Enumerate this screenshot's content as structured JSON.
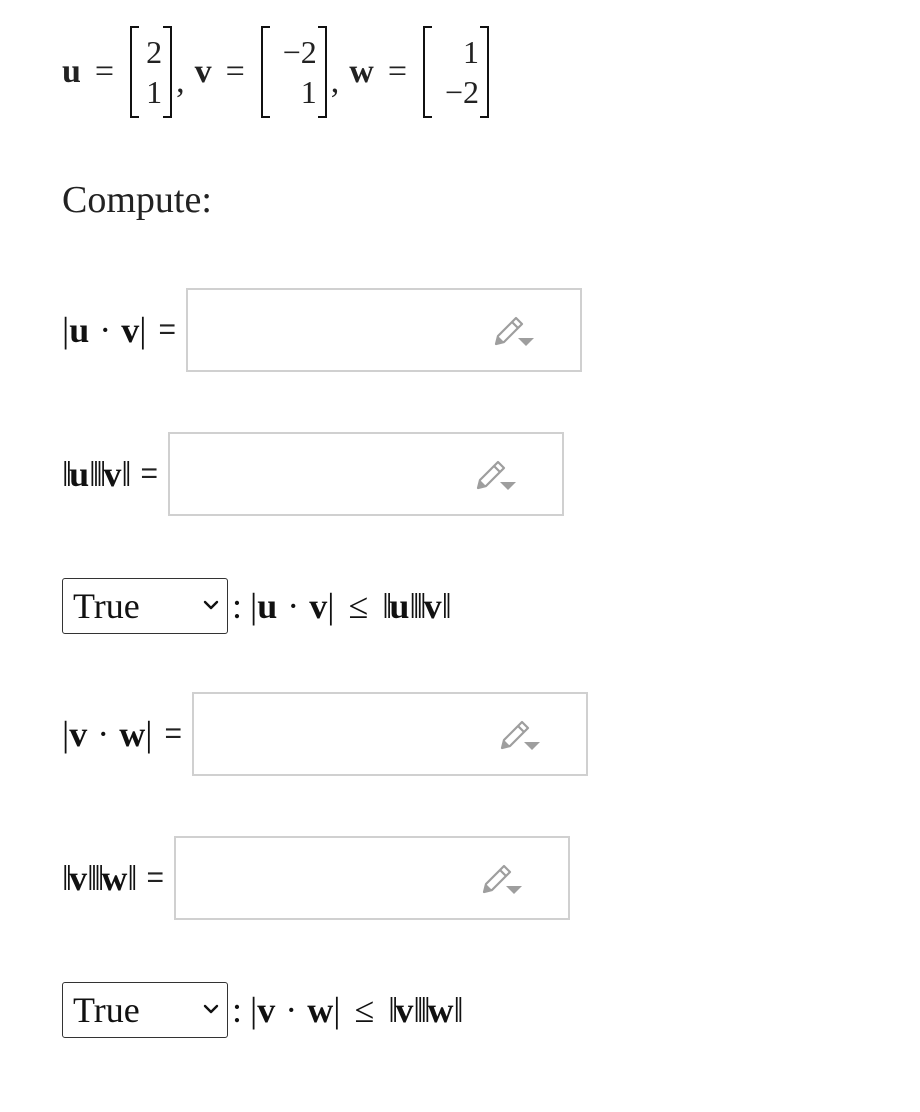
{
  "vectors": {
    "u": {
      "name": "u",
      "entries": [
        "2",
        "1"
      ]
    },
    "v": {
      "name": "v",
      "entries": [
        "−2",
        "1"
      ]
    },
    "w": {
      "name": "w",
      "entries": [
        "1",
        "−2"
      ]
    }
  },
  "compute_label": "Compute:",
  "questions": [
    {
      "id": "abs_u_dot_v",
      "value": "",
      "icon": "pencil-edit-icon"
    },
    {
      "id": "norm_u_norm_v",
      "value": "",
      "icon": "pencil-edit-icon"
    },
    {
      "id": "cs_uv",
      "selected": "True"
    },
    {
      "id": "abs_v_dot_w",
      "value": "",
      "icon": "pencil-edit-icon"
    },
    {
      "id": "norm_v_norm_w",
      "value": "",
      "icon": "pencil-edit-icon"
    },
    {
      "id": "cs_vw",
      "selected": "True"
    }
  ],
  "symbols": {
    "equals": "=",
    "colon": ":",
    "dot": "·",
    "leq": "≤",
    "bar": "|",
    "dbar": "‖"
  },
  "colors": {
    "box_border": "#d0d0d0",
    "icon": "#9e9e9e",
    "select_border": "#333333"
  }
}
